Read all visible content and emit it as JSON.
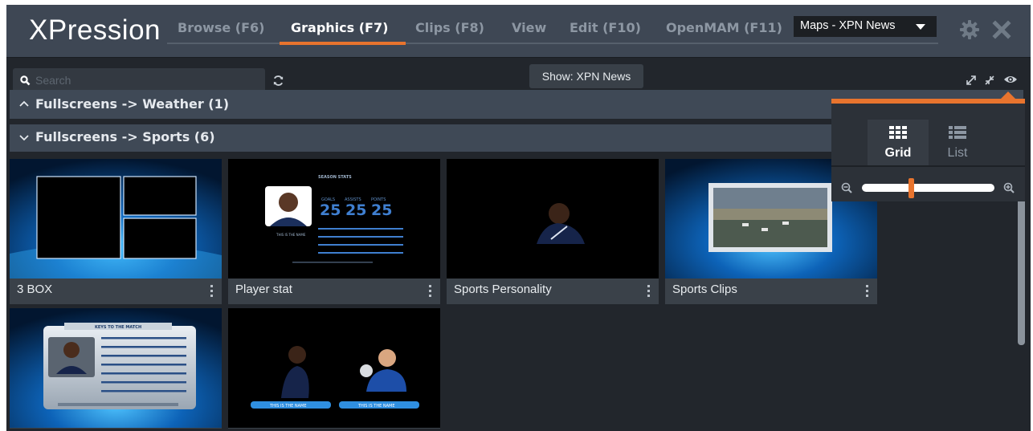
{
  "app": {
    "logo": "XPression"
  },
  "nav": {
    "tabs": [
      {
        "label": "Browse (F6)",
        "active": false
      },
      {
        "label": "Graphics (F7)",
        "active": true
      },
      {
        "label": "Clips (F8)",
        "active": false
      },
      {
        "label": "View",
        "active": false
      },
      {
        "label": "Edit (F10)",
        "active": false
      },
      {
        "label": "OpenMAM (F11)",
        "active": false
      }
    ],
    "project_select": "Maps - XPN News"
  },
  "toolbar": {
    "search_placeholder": "Search",
    "show_label": "Show: XPN News"
  },
  "groups": [
    {
      "label": "Fullscreens -> Weather (1)",
      "expanded": false
    },
    {
      "label": "Fullscreens -> Sports (6)",
      "expanded": true
    }
  ],
  "cards": [
    {
      "title": "3 BOX"
    },
    {
      "title": "Player stat"
    },
    {
      "title": "Sports Personality"
    },
    {
      "title": "Sports Clips"
    },
    {
      "title": ""
    },
    {
      "title": ""
    }
  ],
  "thumb_text": {
    "season_stats": "SEASON STATS",
    "goals": "GOALS",
    "assists": "ASSISTS",
    "points": "POINTS",
    "goals_val": "25",
    "assists_val": "25",
    "points_val": "25",
    "name_label": "THIS IS THE NAME",
    "keys_title": "KEYS TO THE MATCH"
  },
  "view_popover": {
    "grid_label": "Grid",
    "list_label": "List",
    "selected": "Grid",
    "zoom_level": 0.37
  },
  "colors": {
    "accent": "#e8742e",
    "header_bg": "#3e4754",
    "app_bg": "#22262c"
  }
}
